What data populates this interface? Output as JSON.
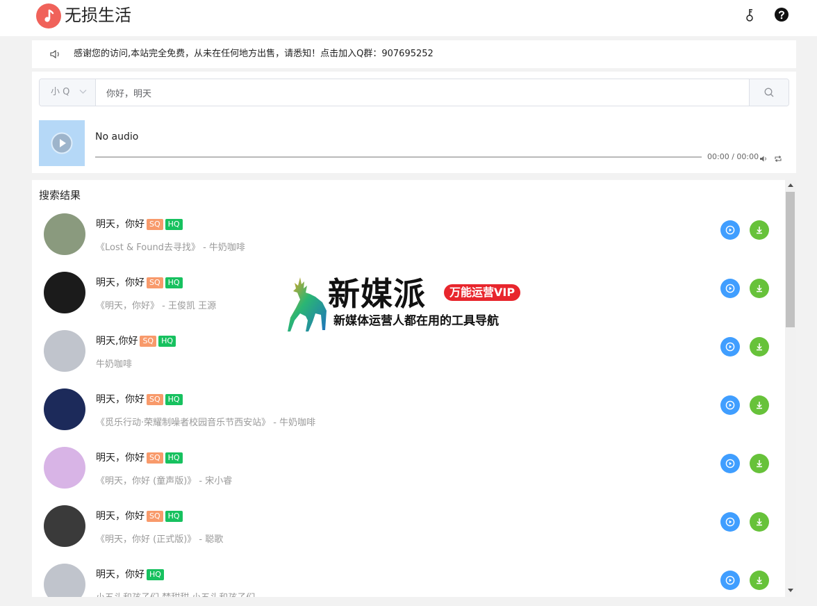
{
  "header": {
    "site_title": "无损生活",
    "icons": [
      "music-note-icon",
      "key-icon",
      "help-icon"
    ]
  },
  "notice": {
    "icon": "speaker-icon",
    "text": "感谢您的访问,本站完全免费，从未在任何地方出售，请悉知！点击加入Q群：907695252"
  },
  "search": {
    "source_selected": "小 Q",
    "query": "你好，明天",
    "button_icon": "search-icon"
  },
  "player": {
    "title": "No audio",
    "time": "00:00 / 00:00",
    "progress": 0,
    "cover_color": "#b5d8f7"
  },
  "results": {
    "heading": "搜索结果",
    "items": [
      {
        "title": "明天，你好",
        "badges": [
          "SQ",
          "HQ"
        ],
        "subtitle": "《Lost & Found去寻找》 - 牛奶咖啡",
        "avatar_color": "#8a9a7e"
      },
      {
        "title": "明天，你好",
        "badges": [
          "SQ",
          "HQ"
        ],
        "subtitle": "《明天，你好》 - 王俊凯 王源",
        "avatar_color": "#1b1b1b"
      },
      {
        "title": "明天,你好",
        "badges": [
          "SQ",
          "HQ"
        ],
        "subtitle": "牛奶咖啡",
        "avatar_color": "#c0c4cc"
      },
      {
        "title": "明天，你好",
        "badges": [
          "SQ",
          "HQ"
        ],
        "subtitle": "《觅乐行动·荣耀制噪者校园音乐节西安站》 - 牛奶咖啡",
        "avatar_color": "#1c2a5a"
      },
      {
        "title": "明天，你好",
        "badges": [
          "SQ",
          "HQ"
        ],
        "subtitle": "《明天，你好 (童声版)》 - 宋小睿",
        "avatar_color": "#d8b4e6"
      },
      {
        "title": "明天，你好",
        "badges": [
          "SQ",
          "HQ"
        ],
        "subtitle": "《明天，你好 (正式版)》 - 聪歌",
        "avatar_color": "#3a3a3a"
      },
      {
        "title": "明天，你好",
        "badges": [
          "HQ"
        ],
        "subtitle": "小五头和孩子们 梵甜甜  小五头和孩子们",
        "avatar_color": "#c0c4cc"
      }
    ]
  },
  "watermark": {
    "brand": "新媒派",
    "tag": "万能运营VIP",
    "slogan": "新媒体运营人都在用的工具导航"
  },
  "colors": {
    "play_button": "#409eff",
    "download_button": "#67c23a",
    "badge_sq": "#f89a6b",
    "badge_hq": "#17c15f",
    "logo": "#f0625a"
  }
}
